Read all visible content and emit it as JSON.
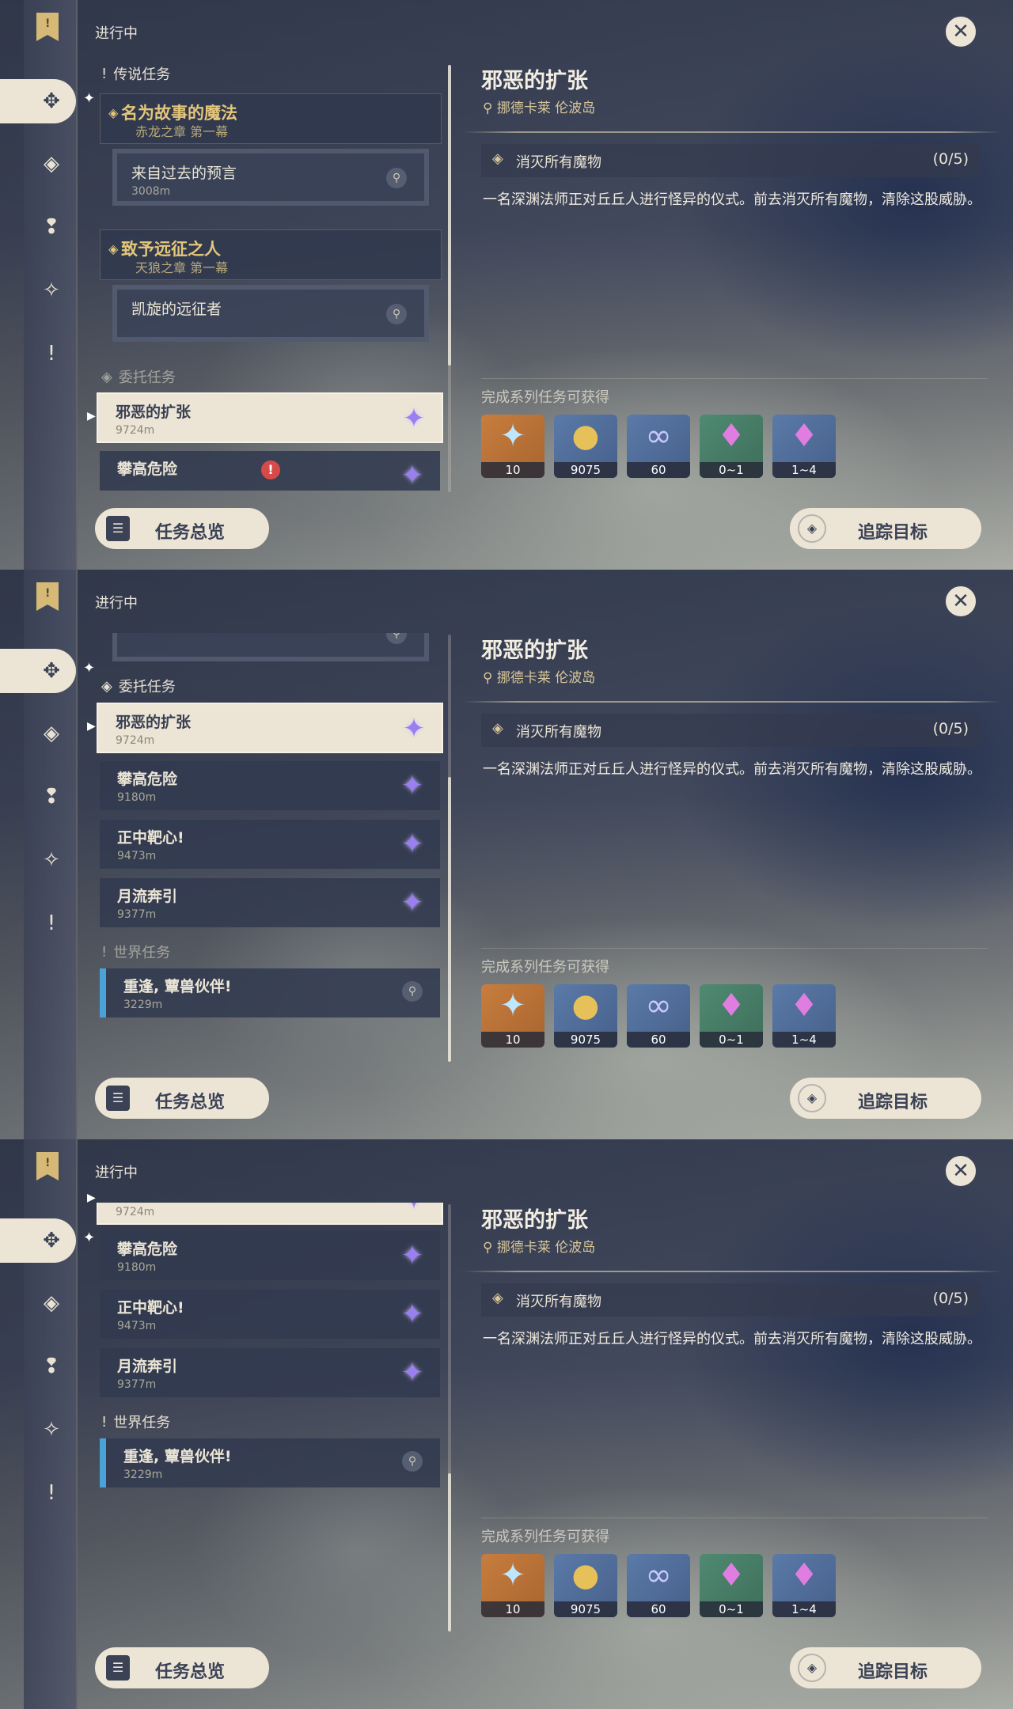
{
  "ongoing_label": "进行中",
  "sections": {
    "legend": "传说任务",
    "commission": "委托任务",
    "world": "世界任务"
  },
  "legend_quests": [
    {
      "title": "名为故事的魔法",
      "chapter": "赤龙之章 第一幕",
      "sub_title": "来自过去的预言",
      "sub_distance": "3008m"
    },
    {
      "title": "致予远征之人",
      "chapter": "天狼之章 第一幕",
      "sub_title": "凯旋的远征者",
      "sub_distance": ""
    }
  ],
  "commissions": [
    {
      "title": "邪恶的扩张",
      "distance": "9724m"
    },
    {
      "title": "攀高危险",
      "distance": "9180m"
    },
    {
      "title": "正中靶心!",
      "distance": "9473m"
    },
    {
      "title": "月流奔引",
      "distance": "9377m"
    }
  ],
  "world_quests": [
    {
      "title": "重逢, 蕈兽伙伴!",
      "distance": "3229m"
    }
  ],
  "detail": {
    "title": "邪恶的扩张",
    "location": "挪德卡莱 伦波岛",
    "objective": "消灭所有魔物",
    "progress": "(0/5)",
    "description": "一名深渊法师正对丘丘人进行怪异的仪式。前去消灭所有魔物，清除这股威胁。",
    "rewards_label": "完成系列任务可获得",
    "rewards": [
      {
        "icon": "primogem-icon",
        "qty": "10"
      },
      {
        "icon": "mora-icon",
        "qty": "9075"
      },
      {
        "icon": "friendship-exp-icon",
        "qty": "60"
      },
      {
        "icon": "crystal-ore-icon",
        "qty": "0~1"
      },
      {
        "icon": "crystal-cluster-icon",
        "qty": "1~4"
      }
    ]
  },
  "buttons": {
    "overview": "任务总览",
    "track": "追踪目标"
  },
  "colors": {
    "panel_light": "#ece5d6",
    "panel_dark": "#3b4256",
    "gold": "#e5c77b",
    "world_accent": "#4aa3d8",
    "alert": "#d84a4a"
  }
}
